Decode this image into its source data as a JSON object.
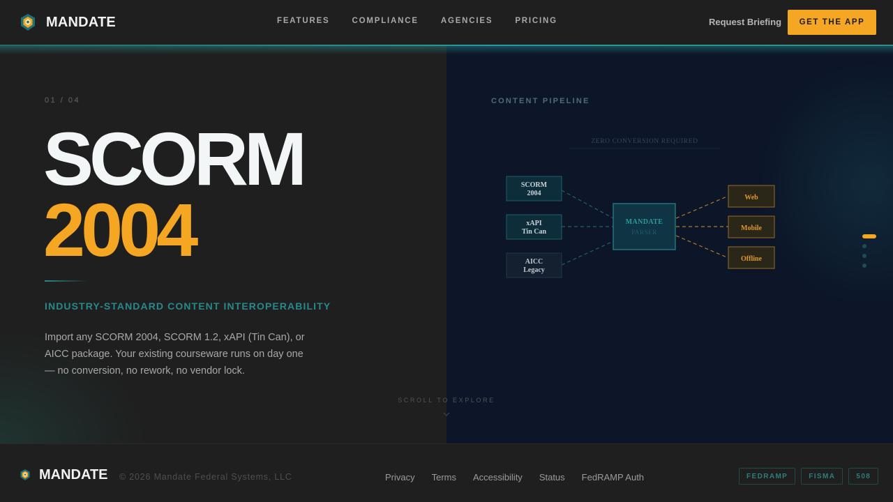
{
  "brand": {
    "name": "MANDATE",
    "logo_icon": "mandate-shield-icon"
  },
  "nav": {
    "items": [
      {
        "label": "FEATURES"
      },
      {
        "label": "COMPLIANCE"
      },
      {
        "label": "AGENCIES"
      },
      {
        "label": "PRICING"
      }
    ],
    "request_label": "Request Briefing",
    "cta_label": "GET THE APP"
  },
  "hero": {
    "counter": "01 / 04",
    "title_line1": "SCORM",
    "title_line2": "2004",
    "subtitle": "INDUSTRY-STANDARD CONTENT INTEROPERABILITY",
    "description": "Import any SCORM 2004, SCORM 1.2, xAPI (Tin Can), or AICC package. Your existing courseware runs on day one — no conversion, no rework, no vendor lock."
  },
  "pipeline": {
    "label": "CONTENT PIPELINE",
    "banner": "ZERO CONVERSION REQUIRED",
    "inputs": [
      {
        "line1": "SCORM",
        "line2": "2004"
      },
      {
        "line1": "xAPI",
        "line2": "Tin Can"
      },
      {
        "line1": "AICC",
        "line2": "Legacy"
      }
    ],
    "hub": {
      "line1": "MANDATE",
      "line2": "PARSER"
    },
    "outputs": [
      "Web",
      "Mobile",
      "Offline"
    ]
  },
  "slides": {
    "total": 4,
    "active": 1
  },
  "scroll_hint": "SCROLL TO EXPLORE",
  "footer": {
    "brand": "MANDATE",
    "copyright": "© 2026 Mandate Federal Systems, LLC",
    "links": [
      "Privacy",
      "Terms",
      "Accessibility",
      "Status",
      "FedRAMP Auth"
    ],
    "badges": [
      "FEDRAMP",
      "FISMA",
      "508"
    ]
  },
  "colors": {
    "accent": "#f5a623",
    "teal": "#27898b",
    "background": "#1f1f1f",
    "panel": "#0c1628"
  }
}
